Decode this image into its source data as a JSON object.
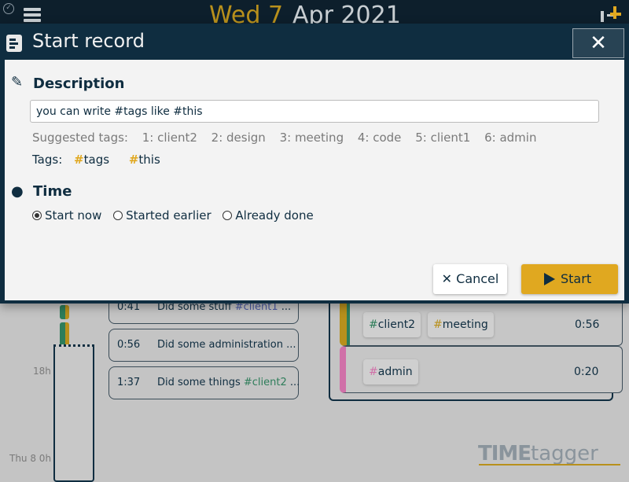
{
  "topbar": {
    "day": "Wed 7",
    "month": "Apr 2021"
  },
  "timeline": {
    "labels": [
      "18h",
      "Thu 8 0h"
    ],
    "records": [
      {
        "duration": "0:41",
        "text": "Did some stuff ",
        "tag": "#client1",
        "tag_color": "#4a5aa0",
        "more": " ..."
      },
      {
        "duration": "0:56",
        "text": "Did some administration ...",
        "tag": "",
        "more": ""
      },
      {
        "duration": "1:37",
        "text": "Did some things ",
        "tag": "#client2",
        "tag_color": "#2e7d5a",
        "more": " ..."
      }
    ]
  },
  "panel": {
    "records": [
      {
        "tags": [
          "client2",
          "meeting"
        ],
        "tag_colors": [
          "#2e7d5a",
          "#b8901c"
        ],
        "duration": "0:56"
      },
      {
        "tags": [
          "admin"
        ],
        "tag_colors": [
          "#d070a8"
        ],
        "duration": "0:20"
      }
    ]
  },
  "logo": {
    "bold": "TIME",
    "light": "tagger"
  },
  "dialog": {
    "title": "Start record",
    "close": "✕",
    "description_heading": "Description",
    "description_value": "you can write #tags like #this",
    "suggested_label": "Suggested tags:",
    "suggested": [
      "1: client2",
      "2: design",
      "3: meeting",
      "4: code",
      "5: client1",
      "6: admin"
    ],
    "tags_label": "Tags:",
    "tags": [
      "tags",
      "this"
    ],
    "time_heading": "Time",
    "time_options": [
      "Start now",
      "Started earlier",
      "Already done"
    ],
    "selected_time": "Start now",
    "cancel": "Cancel",
    "start": "Start",
    "colors": {
      "accent": "#e0a820",
      "dark": "#0f2d40"
    }
  }
}
